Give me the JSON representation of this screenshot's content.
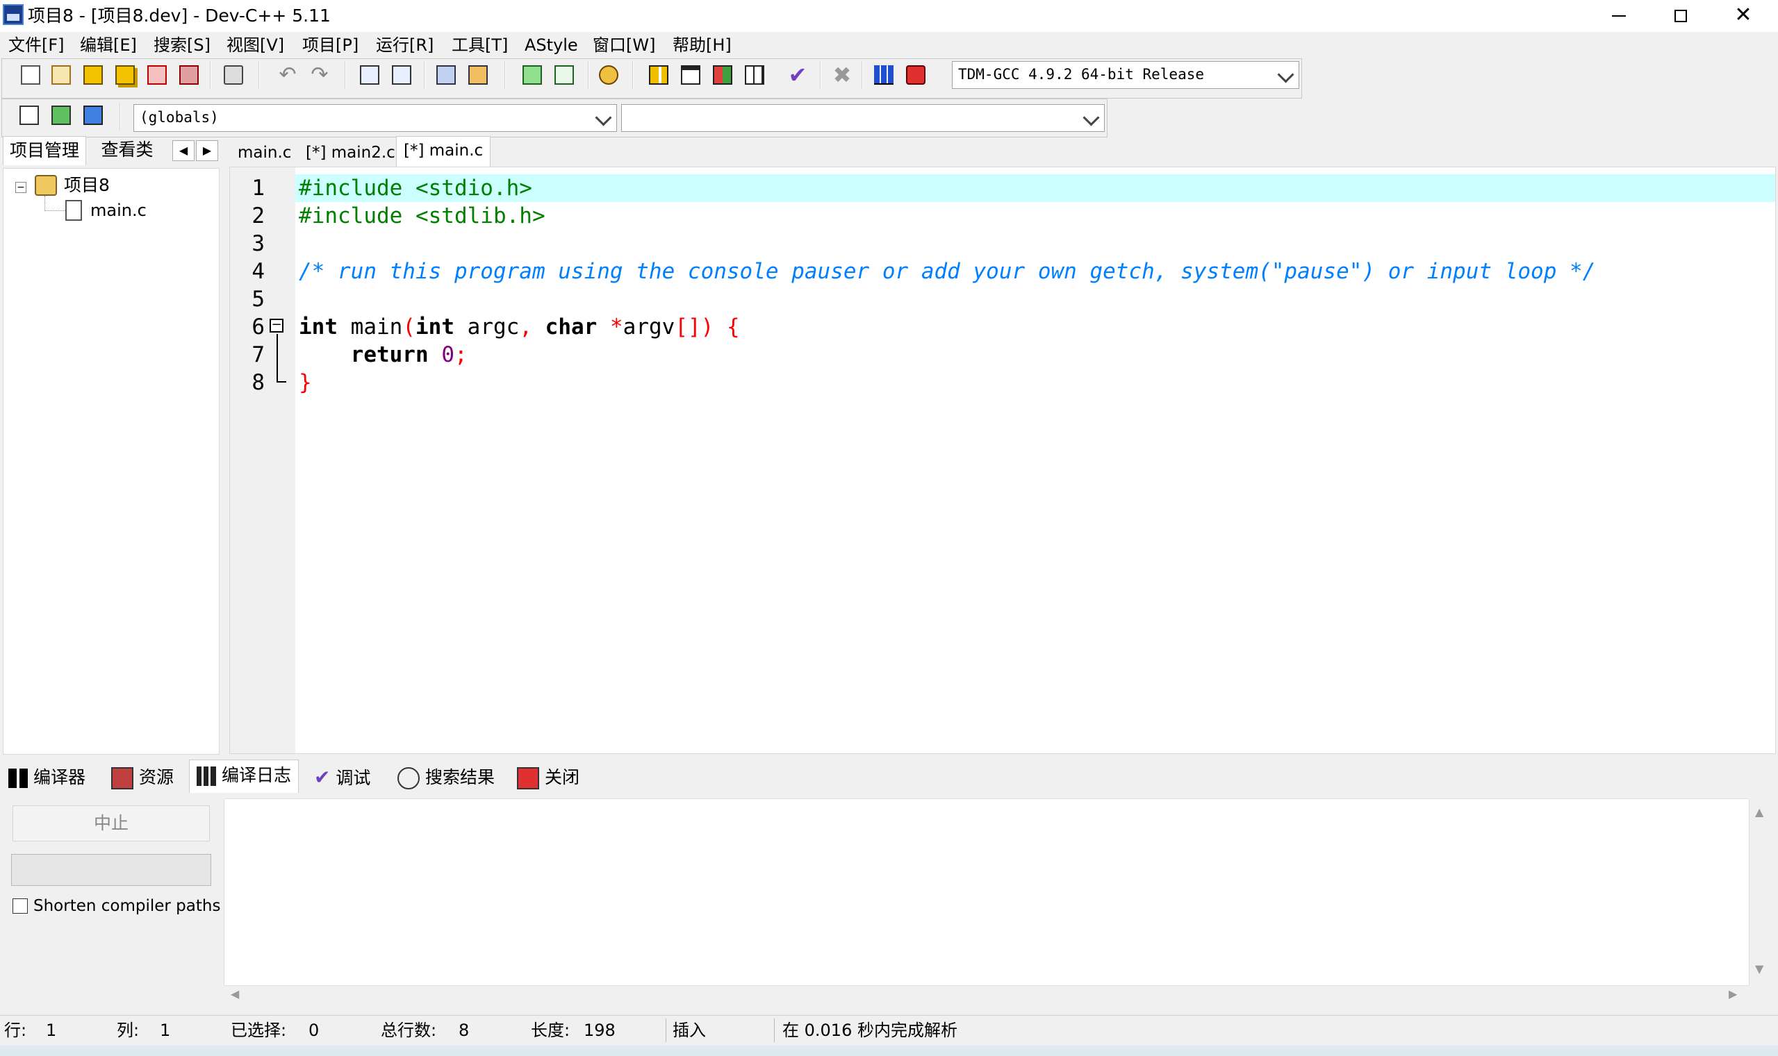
{
  "window": {
    "title": "项目8 - [项目8.dev] - Dev-C++ 5.11",
    "minimize_icon": "minimize-icon",
    "maximize_icon": "restore-icon",
    "close_icon": "close-icon"
  },
  "menu": [
    "文件[F]",
    "编辑[E]",
    "搜索[S]",
    "视图[V]",
    "项目[P]",
    "运行[R]",
    "工具[T]",
    "AStyle",
    "窗口[W]",
    "帮助[H]"
  ],
  "toolbar": {
    "compiler_select": "TDM-GCC 4.9.2 64-bit Release",
    "scope_select": "(globals)",
    "member_select": ""
  },
  "left_panel": {
    "tabs": [
      "项目管理",
      "查看类"
    ],
    "project_name": "项目8",
    "files": [
      "main.c"
    ]
  },
  "editor": {
    "tabs": [
      "main.c",
      "[*] main2.c",
      "[*] main.c"
    ],
    "active_tab_index": 2,
    "line_numbers": [
      "1",
      "2",
      "3",
      "4",
      "5",
      "6",
      "7",
      "8"
    ],
    "code": {
      "l1": "#include <stdio.h>",
      "l2": "#include <stdlib.h>",
      "l4": "/* run this program using the console pauser or add your own getch, system(\"pause\") or input loop */",
      "l6_kw1": "int",
      "l6_name": " main",
      "l6_p1": "(",
      "l6_kw2": "int",
      "l6_argc": " argc",
      "l6_comma": ",",
      "l6_kw3": " char",
      "l6_star": " *",
      "l6_argv": "argv",
      "l6_rest": "[]) {",
      "l7_kw": "return",
      "l7_num": "0",
      "l7_semi": ";",
      "l8": "}"
    }
  },
  "bottom_panel": {
    "tabs": [
      "编译器",
      "资源",
      "编译日志",
      "调试",
      "搜索结果",
      "关闭"
    ],
    "active_tab_index": 2,
    "abort_button": "中止",
    "shorten_paths_label": "Shorten compiler paths",
    "shorten_paths_checked": false
  },
  "status_bar": {
    "row_label": "行:",
    "row_value": "1",
    "col_label": "列:",
    "col_value": "1",
    "selected_label": "已选择:",
    "selected_value": "0",
    "total_lines_label": "总行数:",
    "total_lines_value": "8",
    "length_label": "长度:",
    "length_value": "198",
    "mode": "插入",
    "parse_message": "在 0.016 秒内完成解析"
  }
}
